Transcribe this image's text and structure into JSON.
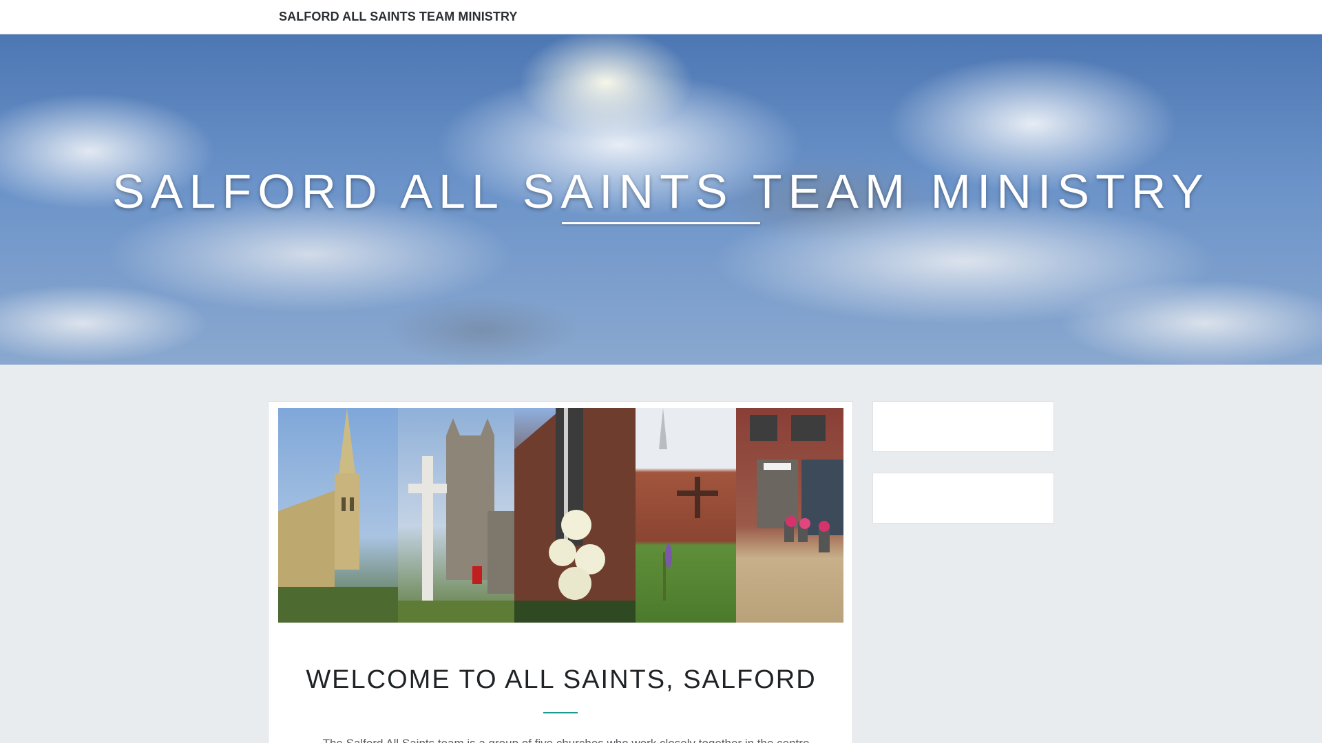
{
  "nav": {
    "site_title": "SALFORD ALL SAINTS TEAM MINISTRY"
  },
  "hero": {
    "title": "SALFORD ALL SAINTS TEAM MINISTRY"
  },
  "main": {
    "title": "WELCOME TO ALL SAINTS, SALFORD",
    "intro": "The Salford All Saints team is a group of five churches who work closely together in the centre"
  },
  "colors": {
    "accent": "#1a9a8a",
    "page_bg": "#e9ecef"
  }
}
